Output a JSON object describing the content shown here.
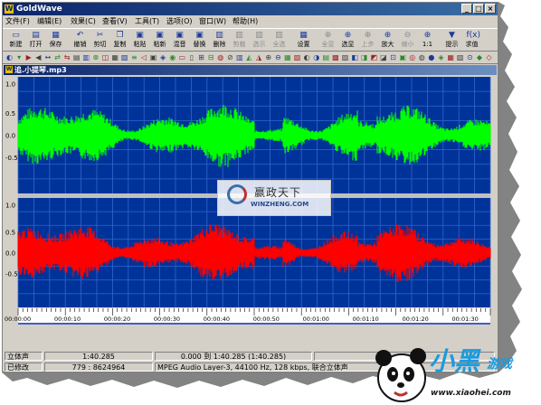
{
  "app": {
    "title": "GoldWave",
    "icon_letter": "W"
  },
  "window_controls": {
    "minimize": "_",
    "maximize": "□",
    "close": "×"
  },
  "menu": [
    {
      "label": "文件(F)"
    },
    {
      "label": "编辑(E)"
    },
    {
      "label": "效果(C)"
    },
    {
      "label": "查看(V)"
    },
    {
      "label": "工具(T)"
    },
    {
      "label": "选项(O)"
    },
    {
      "label": "窗口(W)"
    },
    {
      "label": "帮助(H)"
    }
  ],
  "toolbar": [
    {
      "label": "新建",
      "icon": "▭",
      "enabled": true
    },
    {
      "label": "打开",
      "icon": "▤",
      "enabled": true
    },
    {
      "label": "保存",
      "icon": "▦",
      "enabled": true
    },
    {
      "label": "撤销",
      "icon": "↶",
      "enabled": true
    },
    {
      "label": "剪切",
      "icon": "✂",
      "enabled": true
    },
    {
      "label": "复制",
      "icon": "❐",
      "enabled": true
    },
    {
      "label": "粘贴",
      "icon": "▣",
      "enabled": true
    },
    {
      "label": "粘新",
      "icon": "▣",
      "enabled": true
    },
    {
      "label": "混音",
      "icon": "▣",
      "enabled": true
    },
    {
      "label": "替换",
      "icon": "▣",
      "enabled": true
    },
    {
      "label": "删除",
      "icon": "▥",
      "enabled": true
    },
    {
      "label": "剪裁",
      "icon": "▥",
      "enabled": false
    },
    {
      "label": "选示",
      "icon": "▥",
      "enabled": false
    },
    {
      "label": "全选",
      "icon": "▥",
      "enabled": false
    },
    {
      "label": "设置",
      "icon": "▦",
      "enabled": true
    },
    {
      "label": "全显",
      "icon": "⊕",
      "enabled": false
    },
    {
      "label": "选显",
      "icon": "⊕",
      "enabled": true
    },
    {
      "label": "上步",
      "icon": "⊕",
      "enabled": false
    },
    {
      "label": "放大",
      "icon": "⊕",
      "enabled": true
    },
    {
      "label": "缩小",
      "icon": "⊖",
      "enabled": false
    },
    {
      "label": "1:1",
      "icon": "⊕",
      "enabled": true
    },
    {
      "label": "提示",
      "icon": "▼",
      "enabled": true
    },
    {
      "label": "求值",
      "icon": "f(x)",
      "enabled": true
    }
  ],
  "document": {
    "title": "追.小提琴.mp3",
    "icon_letter": "W"
  },
  "y_axis_labels": [
    "1.0",
    "0.5",
    "0.0",
    "-0.5",
    "1.0",
    "0.5",
    "0.0",
    "-0.5"
  ],
  "time_labels": [
    "00:00:00",
    "00:00:10",
    "00:00:20",
    "00:00:30",
    "00:00:40",
    "00:00:50",
    "00:01:00",
    "00:01:10",
    "00:01:20",
    "00:01:30"
  ],
  "status": {
    "channel": "立体声",
    "length": "1:40.285",
    "selection": "0.000 到 1:40.285 (1:40.285)",
    "modified": "已修改",
    "position": "779 : 8624964",
    "format": "MPEG Audio Layer-3, 44100 Hz, 128 kbps, 联合立体声"
  },
  "watermark": {
    "cn": "赢政天下",
    "en": "WINZHENG.COM"
  },
  "logo": {
    "cn": "小黑",
    "cn2": "游戏",
    "url": "www.xiaohei.com"
  },
  "colors": {
    "wave_bg": "#003399",
    "grid": "#3366cc",
    "left_channel": "#00ff00",
    "right_channel": "#ff0000",
    "title_bar": "#0a246a"
  }
}
